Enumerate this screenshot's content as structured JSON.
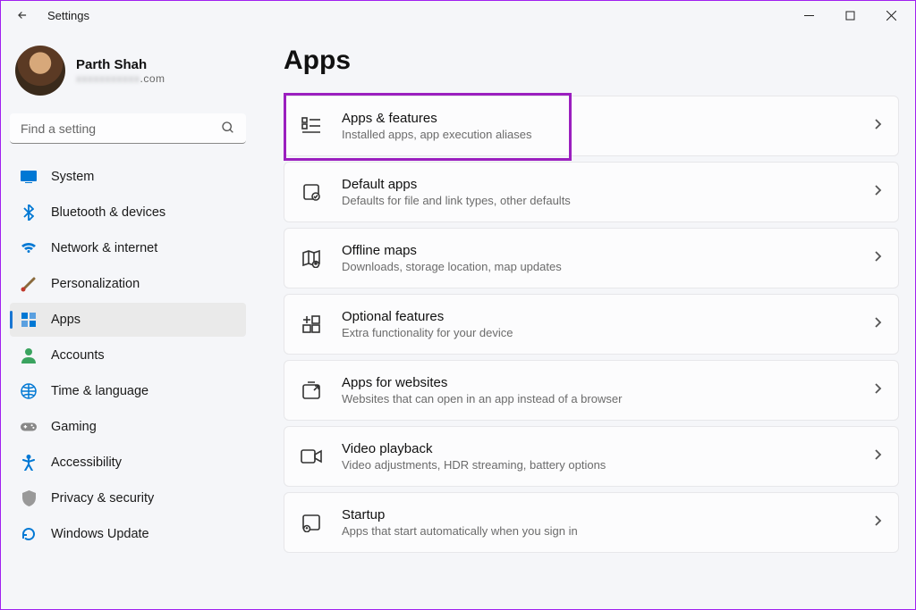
{
  "window": {
    "title": "Settings"
  },
  "profile": {
    "name": "Parth Shah",
    "email_suffix": ".com"
  },
  "search": {
    "placeholder": "Find a setting"
  },
  "nav": [
    {
      "id": "system",
      "label": "System",
      "icon": "system-icon",
      "active": false
    },
    {
      "id": "bluetooth",
      "label": "Bluetooth & devices",
      "icon": "bluetooth-icon",
      "active": false
    },
    {
      "id": "network",
      "label": "Network & internet",
      "icon": "wifi-icon",
      "active": false
    },
    {
      "id": "personalization",
      "label": "Personalization",
      "icon": "brush-icon",
      "active": false
    },
    {
      "id": "apps",
      "label": "Apps",
      "icon": "apps-icon",
      "active": true
    },
    {
      "id": "accounts",
      "label": "Accounts",
      "icon": "person-icon",
      "active": false
    },
    {
      "id": "time",
      "label": "Time & language",
      "icon": "globe-clock-icon",
      "active": false
    },
    {
      "id": "gaming",
      "label": "Gaming",
      "icon": "gamepad-icon",
      "active": false
    },
    {
      "id": "accessibility",
      "label": "Accessibility",
      "icon": "accessibility-icon",
      "active": false
    },
    {
      "id": "privacy",
      "label": "Privacy & security",
      "icon": "shield-icon",
      "active": false
    },
    {
      "id": "update",
      "label": "Windows Update",
      "icon": "update-icon",
      "active": false
    }
  ],
  "page": {
    "title": "Apps",
    "cards": [
      {
        "id": "apps-features",
        "title": "Apps & features",
        "subtitle": "Installed apps, app execution aliases",
        "icon": "list-icon",
        "highlighted": true
      },
      {
        "id": "default-apps",
        "title": "Default apps",
        "subtitle": "Defaults for file and link types, other defaults",
        "icon": "default-icon",
        "highlighted": false
      },
      {
        "id": "offline-maps",
        "title": "Offline maps",
        "subtitle": "Downloads, storage location, map updates",
        "icon": "map-icon",
        "highlighted": false
      },
      {
        "id": "optional-features",
        "title": "Optional features",
        "subtitle": "Extra functionality for your device",
        "icon": "plus-grid-icon",
        "highlighted": false
      },
      {
        "id": "apps-websites",
        "title": "Apps for websites",
        "subtitle": "Websites that can open in an app instead of a browser",
        "icon": "open-app-icon",
        "highlighted": false
      },
      {
        "id": "video-playback",
        "title": "Video playback",
        "subtitle": "Video adjustments, HDR streaming, battery options",
        "icon": "video-icon",
        "highlighted": false
      },
      {
        "id": "startup",
        "title": "Startup",
        "subtitle": "Apps that start automatically when you sign in",
        "icon": "startup-icon",
        "highlighted": false
      }
    ]
  },
  "icons": {
    "system-icon": "#0078d4",
    "bluetooth-icon": "#0078d4",
    "wifi-icon": "#0078d4",
    "brush-icon": "#8a6a3c",
    "apps-icon": "#0078d4",
    "person-icon": "#3aa35f",
    "globe-clock-icon": "#0078d4",
    "gamepad-icon": "#888",
    "accessibility-icon": "#0078d4",
    "shield-icon": "#888",
    "update-icon": "#0078d4"
  }
}
